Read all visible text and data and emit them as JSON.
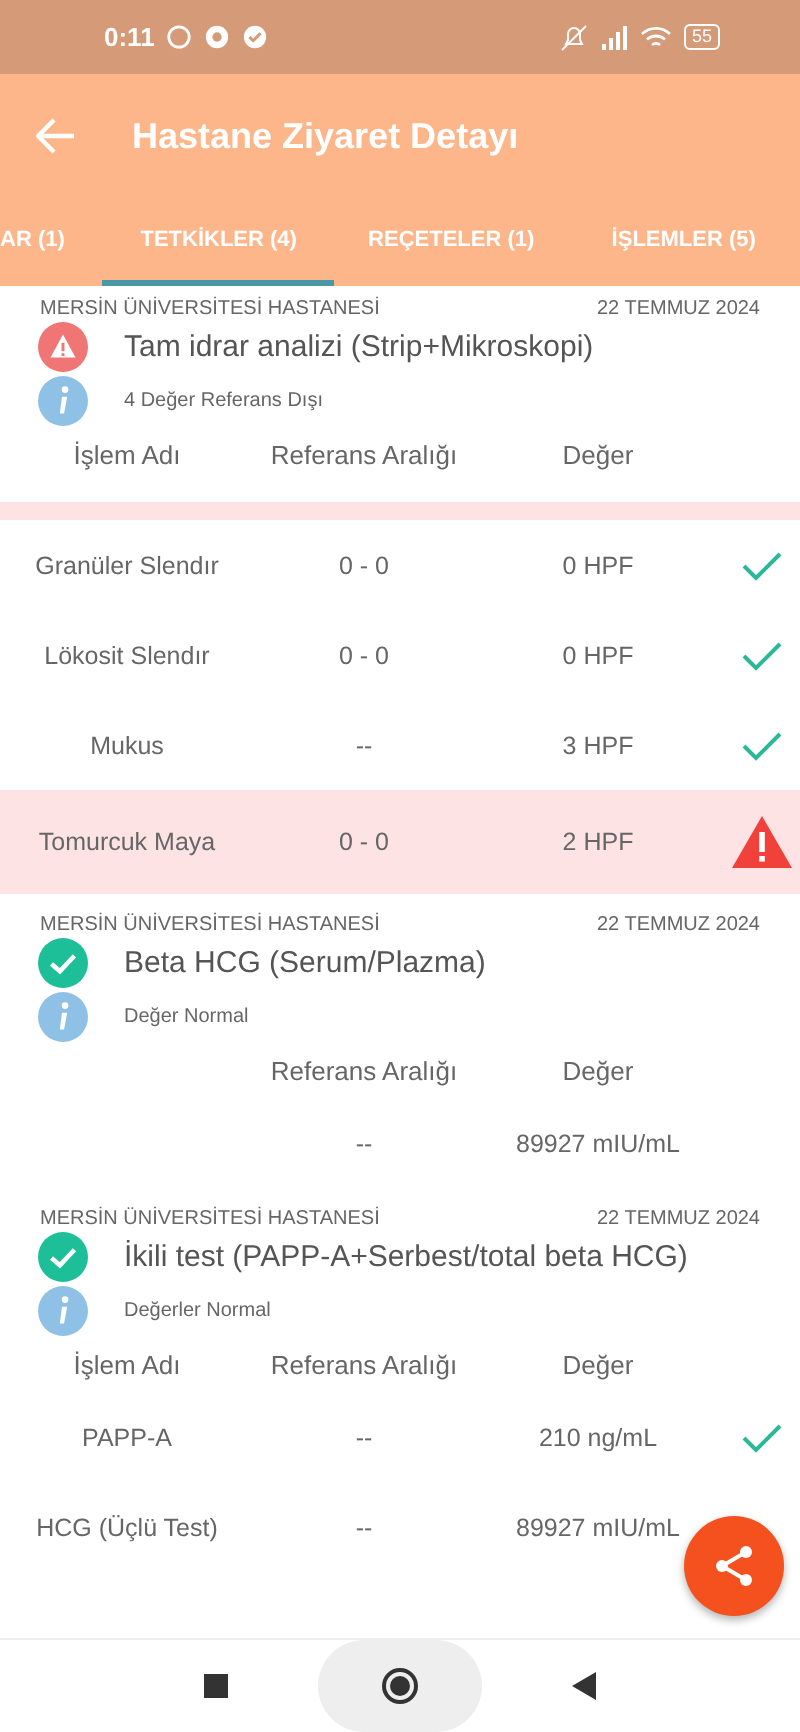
{
  "status_bar": {
    "time": "0:11",
    "battery": "55"
  },
  "app_bar": {
    "title": "Hastane Ziyaret Detayı"
  },
  "tabs": [
    {
      "label": "AR (1)",
      "selected": false
    },
    {
      "label": "TETKİKLER (4)",
      "selected": true
    },
    {
      "label": "REÇETELER (1)",
      "selected": false
    },
    {
      "label": "İŞLEMLER (5)",
      "selected": false
    }
  ],
  "tests": [
    {
      "hospital": "MERSİN ÜNİVERSİTESİ HASTANESİ",
      "date": "22 TEMMUZ 2024",
      "kind": "alert",
      "title": "Tam idrar analizi (Strip+Mikroskopi)",
      "note": "4 Değer Referans Dışı",
      "columns": [
        "İşlem Adı",
        "Referans Aralığı",
        "Değer"
      ],
      "rows": [
        {
          "name": "Granüler Slendır",
          "range": "0 - 0",
          "value": "0 HPF",
          "out_of_range": false
        },
        {
          "name": "Lökosit Slendır",
          "range": "0 - 0",
          "value": "0 HPF",
          "out_of_range": false
        },
        {
          "name": "Mukus",
          "range": "--",
          "value": "3 HPF",
          "out_of_range": false
        },
        {
          "name": "Tomurcuk Maya",
          "range": "0 - 0",
          "value": "2 HPF",
          "out_of_range": true
        }
      ]
    },
    {
      "hospital": "MERSİN ÜNİVERSİTESİ HASTANESİ",
      "date": "22 TEMMUZ 2024",
      "kind": "normal",
      "title": "Beta HCG (Serum/Plazma)",
      "note": "Değer Normal",
      "columns": [
        "",
        "Referans Aralığı",
        "Değer"
      ],
      "rows": [
        {
          "name": "",
          "range": "--",
          "value": "89927 mIU/mL"
        }
      ]
    },
    {
      "hospital": "MERSİN ÜNİVERSİTESİ HASTANESİ",
      "date": "22 TEMMUZ 2024",
      "kind": "normal",
      "title": "İkili test (PAPP-A+Serbest/total beta HCG)",
      "note": "Değerler Normal",
      "columns": [
        "İşlem Adı",
        "Referans Aralığı",
        "Değer"
      ],
      "rows": [
        {
          "name": "PAPP-A",
          "range": "--",
          "value": "210 ng/mL",
          "out_of_range": false
        },
        {
          "name": "HCG (Üçlü Test)",
          "range": "--",
          "value": "89927 mIU/mL"
        }
      ]
    }
  ]
}
